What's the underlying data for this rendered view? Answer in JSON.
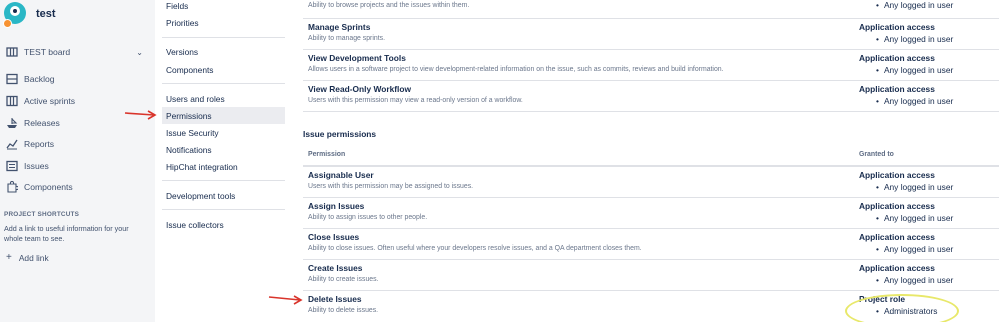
{
  "project": {
    "name": "test"
  },
  "sidebar": {
    "board": {
      "label": "TEST board"
    },
    "items": [
      {
        "label": "Backlog",
        "icon": "backlog-icon"
      },
      {
        "label": "Active sprints",
        "icon": "board-icon"
      },
      {
        "label": "Releases",
        "icon": "ship-icon"
      },
      {
        "label": "Reports",
        "icon": "graph-icon"
      },
      {
        "label": "Issues",
        "icon": "issues-icon"
      },
      {
        "label": "Components",
        "icon": "puzzle-icon"
      }
    ],
    "shortcuts_title": "PROJECT SHORTCUTS",
    "shortcuts_desc": "Add a link to useful information for your whole team to see.",
    "add_link": "Add link"
  },
  "settings_menu": {
    "items": [
      {
        "label": "Fields"
      },
      {
        "label": "Priorities"
      },
      {
        "label": "Versions"
      },
      {
        "label": "Components"
      },
      {
        "label": "Users and roles"
      },
      {
        "label": "Permissions"
      },
      {
        "label": "Issue Security"
      },
      {
        "label": "Notifications"
      },
      {
        "label": "HipChat integration"
      },
      {
        "label": "Development tools"
      },
      {
        "label": "Issue collectors"
      }
    ]
  },
  "project_permissions": {
    "rows": [
      {
        "name": "",
        "desc": "Ability to browse projects and the issues within them.",
        "granted_title": "",
        "granted_item": "Any logged in user"
      },
      {
        "name": "Manage Sprints",
        "desc": "Ability to manage sprints.",
        "granted_title": "Application access",
        "granted_item": "Any logged in user"
      },
      {
        "name": "View Development Tools",
        "desc": "Allows users in a software project to view development-related information on the issue, such as commits, reviews and build information.",
        "granted_title": "Application access",
        "granted_item": "Any logged in user"
      },
      {
        "name": "View Read-Only Workflow",
        "desc": "Users with this permission may view a read-only version of a workflow.",
        "granted_title": "Application access",
        "granted_item": "Any logged in user"
      }
    ]
  },
  "issue_permissions": {
    "title": "Issue permissions",
    "col_permission": "Permission",
    "col_granted": "Granted to",
    "rows": [
      {
        "name": "Assignable User",
        "desc": "Users with this permission may be assigned to issues.",
        "granted_title": "Application access",
        "granted_item": "Any logged in user"
      },
      {
        "name": "Assign Issues",
        "desc": "Ability to assign issues to other people.",
        "granted_title": "Application access",
        "granted_item": "Any logged in user"
      },
      {
        "name": "Close Issues",
        "desc": "Ability to close issues. Often useful where your developers resolve issues, and a QA department closes them.",
        "granted_title": "Application access",
        "granted_item": "Any logged in user"
      },
      {
        "name": "Create Issues",
        "desc": "Ability to create issues.",
        "granted_title": "Application access",
        "granted_item": "Any logged in user"
      },
      {
        "name": "Delete Issues",
        "desc": "Ability to delete issues.",
        "granted_title": "Project role",
        "granted_item": "Administrators"
      }
    ]
  },
  "colors": {
    "sidebar_bg": "#f4f5f7",
    "active_item_bg": "#ebecf0",
    "annotation_arrow": "#d9342b",
    "annotation_ellipse": "#e8e86a"
  }
}
